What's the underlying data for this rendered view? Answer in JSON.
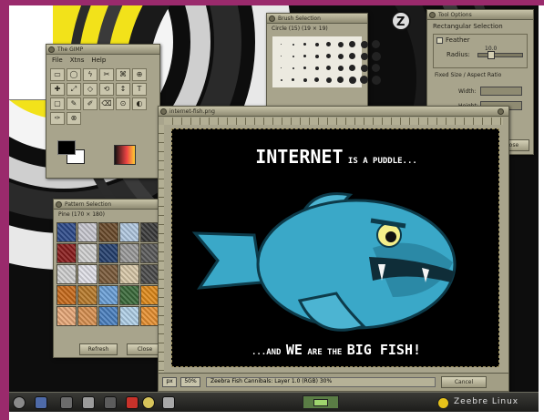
{
  "toolbox": {
    "title": "The GIMP",
    "menu": [
      "File",
      "Xtns",
      "Help"
    ],
    "tool_glyphs": [
      "▭",
      "◯",
      "ϟ",
      "✂",
      "⌘",
      "⊕",
      "✚",
      "⤢",
      "◇",
      "⟲",
      "↕",
      "T",
      "▢",
      "✎",
      "✐",
      "⌫",
      "⊙",
      "◐",
      "✑",
      "⊗"
    ]
  },
  "brushes": {
    "title": "Brush Selection",
    "label": "Circle (15) (19 × 19)"
  },
  "tool_options": {
    "title": "Tool Options",
    "heading": "Rectangular Selection",
    "feather": "Feather",
    "radius": "Radius:",
    "radius_value": "10.0",
    "fixed": "Fixed Size / Aspect Ratio",
    "width": "Width:",
    "height": "Height:",
    "close": "Close"
  },
  "patterns": {
    "title": "Pattern Selection",
    "label": "Pine (170 × 180)",
    "refresh": "Refresh",
    "close": "Close"
  },
  "image_window": {
    "title": "internet-fish.png",
    "headline_big": "INTERNET",
    "headline_small": " IS A PUDDLE...",
    "footer_prefix": "...AND ",
    "footer_we": "WE",
    "footer_mid": " ARE THE ",
    "footer_bigfish": "BIG FISH!",
    "status_unit": "px",
    "status_zoom": "50%",
    "status_text": "Zeebra Fish Cannibals: Layer 1.0 (RGB) 30%",
    "status_cancel": "Cancel"
  },
  "taskbar": {
    "brand": "Zeebre Linux"
  },
  "colors": {
    "frame": "#9a2a6c",
    "panel": "#a8a48c",
    "fish": "#3aa8c8",
    "canvas": "#000000"
  }
}
